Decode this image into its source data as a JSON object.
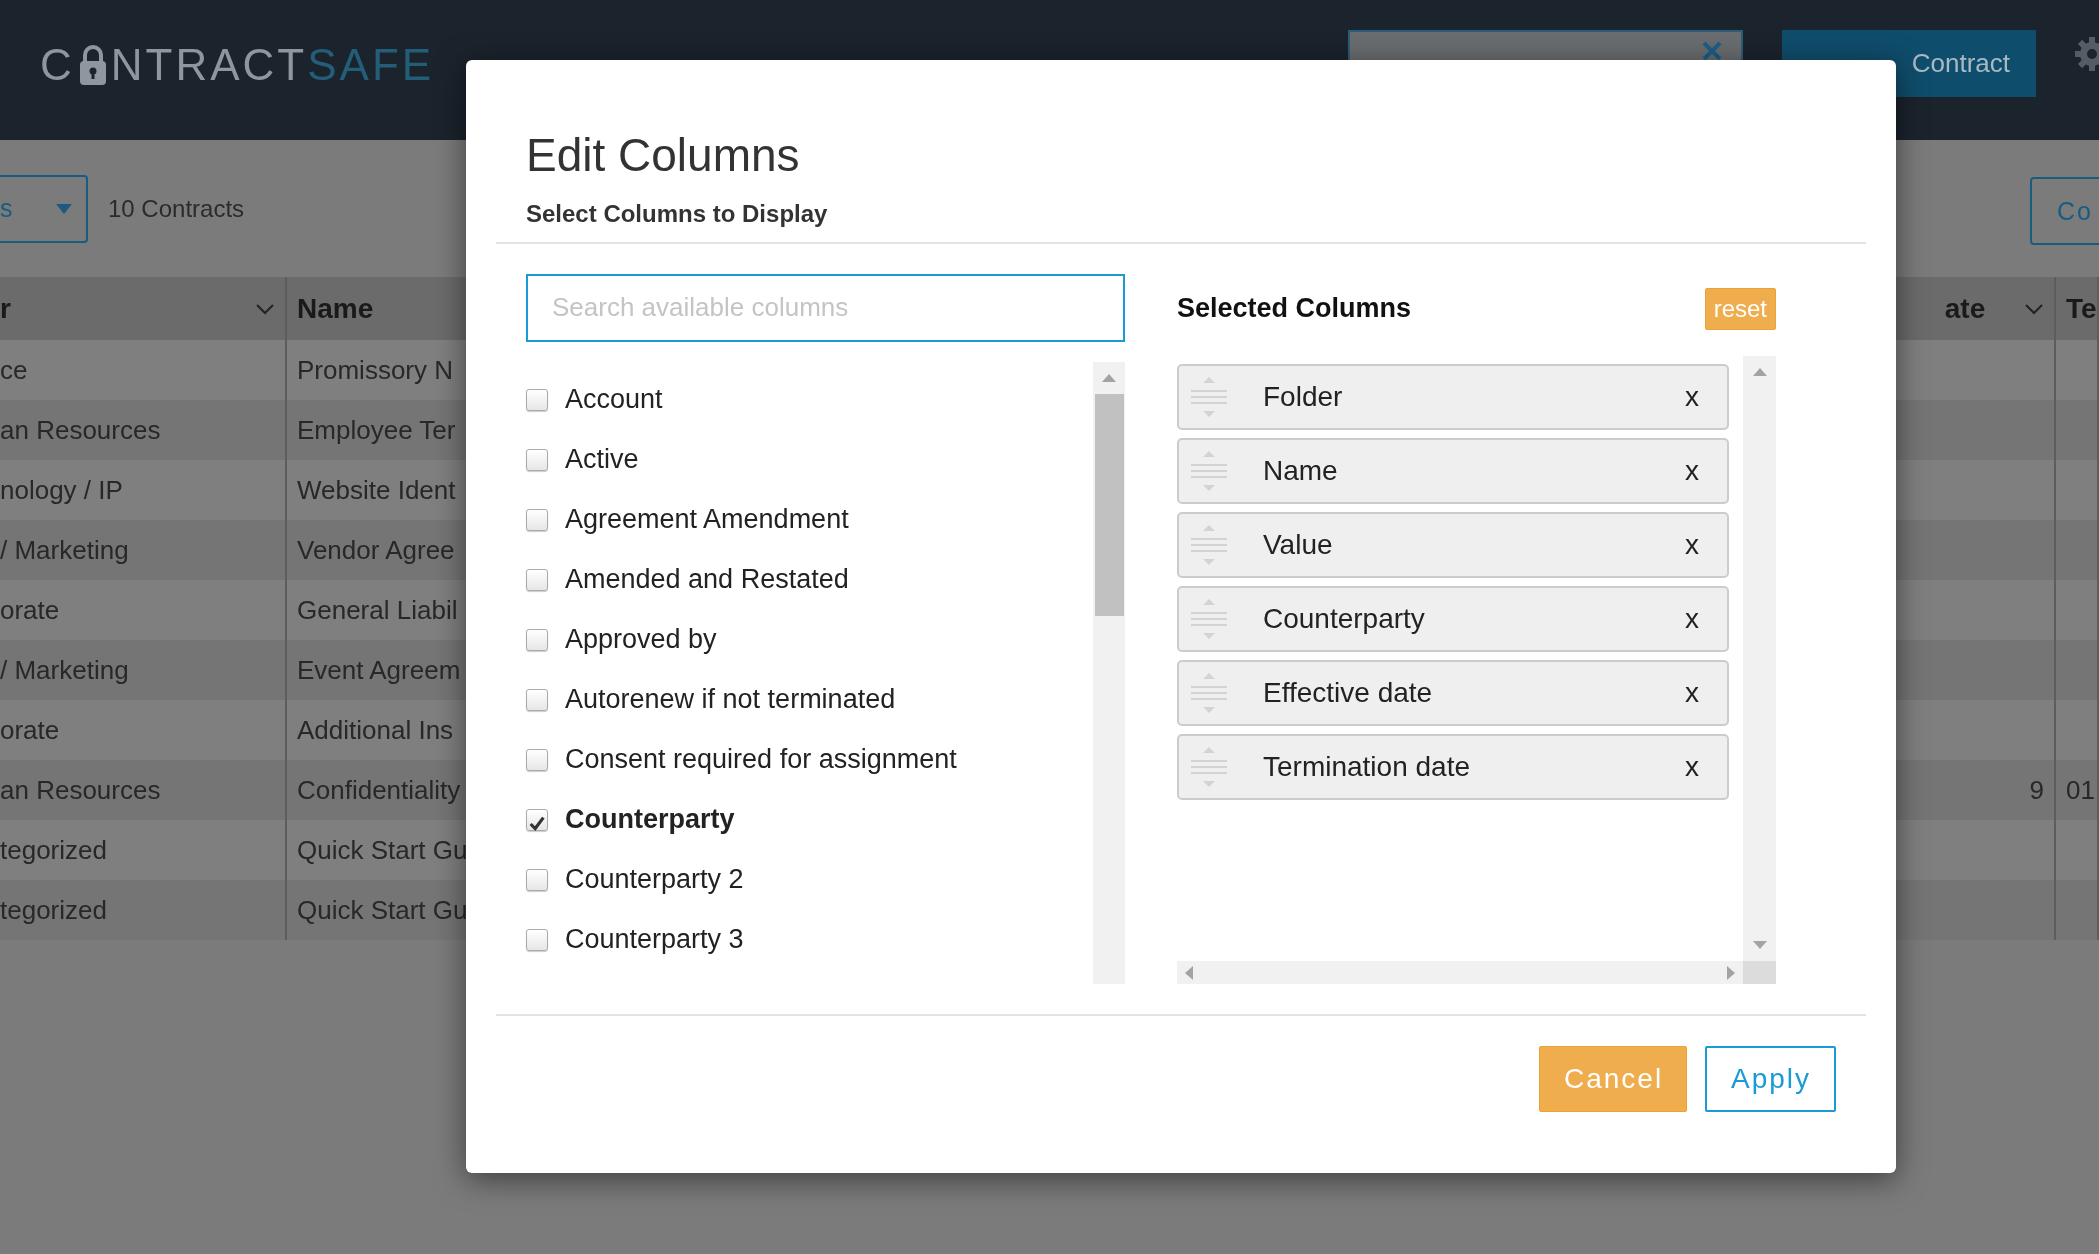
{
  "header": {
    "logo": {
      "lead": "C",
      "rest": "NTRACT",
      "accent": "SAFE"
    },
    "upload_button": "Contract"
  },
  "toolbar": {
    "filter_dropdown": "s",
    "count": "10 Contracts",
    "right_button": "Co"
  },
  "table": {
    "columns": [
      "r",
      "Name",
      "ate",
      "Te"
    ],
    "rows": [
      {
        "folder": "ce",
        "name": "Promissory N",
        "date": "",
        "column_4": ""
      },
      {
        "folder": "an Resources",
        "name": "Employee Ter",
        "date": "",
        "column_4": ""
      },
      {
        "folder": "nology / IP",
        "name": "Website Ident",
        "date": "",
        "column_4": ""
      },
      {
        "folder": " / Marketing",
        "name": "Vendor Agree",
        "date": "",
        "column_4": ""
      },
      {
        "folder": "orate",
        "name": "General Liabil",
        "date": "",
        "column_4": ""
      },
      {
        "folder": " / Marketing",
        "name": "Event Agreem",
        "date": "",
        "column_4": ""
      },
      {
        "folder": "orate",
        "name": "Additional Ins",
        "date": "",
        "column_4": ""
      },
      {
        "folder": "an Resources",
        "name": "Confidentiality",
        "date": "9",
        "column_4": "01"
      },
      {
        "folder": "tegorized",
        "name": "Quick Start Gu",
        "date": "",
        "column_4": ""
      },
      {
        "folder": "tegorized",
        "name": "Quick Start Gu",
        "date": "",
        "column_4": ""
      }
    ]
  },
  "modal": {
    "title": "Edit Columns",
    "subtitle": "Select Columns to Display",
    "search": {
      "placeholder": "Search available columns"
    },
    "available": [
      {
        "label": "Account",
        "checked": false
      },
      {
        "label": "Active",
        "checked": false
      },
      {
        "label": "Agreement Amendment",
        "checked": false
      },
      {
        "label": "Amended and Restated",
        "checked": false
      },
      {
        "label": "Approved by",
        "checked": false
      },
      {
        "label": "Autorenew if not terminated",
        "checked": false
      },
      {
        "label": "Consent required for assignment",
        "checked": false
      },
      {
        "label": "Counterparty",
        "checked": true
      },
      {
        "label": "Counterparty 2",
        "checked": false
      },
      {
        "label": "Counterparty 3",
        "checked": false
      }
    ],
    "selected_title": "Selected Columns",
    "reset": "reset",
    "selected": [
      {
        "label": "Folder",
        "remove": "x"
      },
      {
        "label": "Name",
        "remove": "x"
      },
      {
        "label": "Value",
        "remove": "x"
      },
      {
        "label": "Counterparty",
        "remove": "x"
      },
      {
        "label": "Effective date",
        "remove": "x"
      },
      {
        "label": "Termination date",
        "remove": "x"
      }
    ],
    "buttons": [
      {
        "label": "Cancel",
        "kind": "secondary"
      },
      {
        "label": "Apply",
        "kind": "primary"
      }
    ]
  }
}
